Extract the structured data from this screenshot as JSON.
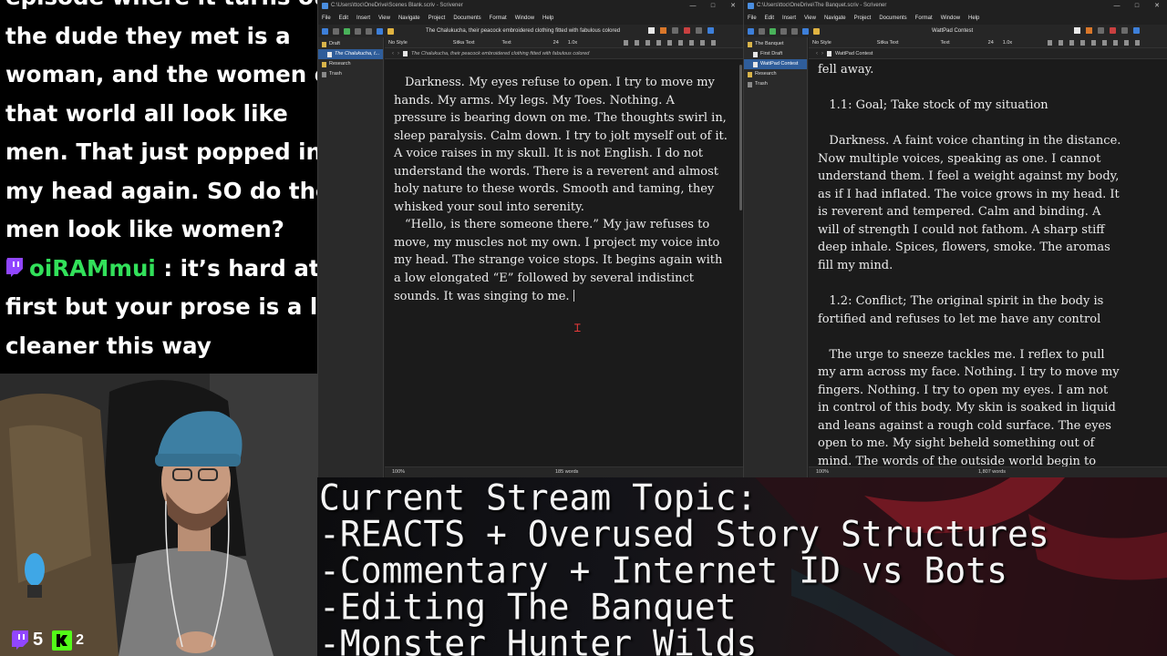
{
  "chat": {
    "lines_before": [
      "episode where it turns out",
      "the dude they met is a",
      "woman, and the women of",
      "that world all look like",
      "men. That just popped into",
      "my head again. SO do the",
      "men look like women?"
    ],
    "message": {
      "username": "oiRAMmui",
      "sep": " :",
      "first_line": " it’s hard at",
      "more_lines": [
        "first but your prose is a lot",
        "cleaner this way"
      ]
    }
  },
  "webcam": {
    "stats": [
      {
        "icon": "twitch-icon",
        "value": "5"
      },
      {
        "icon": "kick-icon",
        "value": "2"
      }
    ]
  },
  "window_left": {
    "title": "C:\\Users\\ttoc\\OneDrive\\Scenes Blank.scriv - Scrivener",
    "controls": [
      "—",
      "□",
      "✕"
    ],
    "menu": [
      "File",
      "Edit",
      "Insert",
      "View",
      "Navigate",
      "Project",
      "Documents",
      "Format",
      "Window",
      "Help"
    ],
    "doc_title": "The Chalukucha, their peacock embroidered clothing fitted with fabulous colored",
    "binder": [
      {
        "label": "Draft",
        "icon": "folder",
        "selected": false,
        "indent": false
      },
      {
        "label": "The Chalukucha, t...",
        "icon": "doc",
        "selected": true,
        "indent": true
      },
      {
        "label": "Research",
        "icon": "folder",
        "selected": false,
        "indent": false
      },
      {
        "label": "Trash",
        "icon": "trash",
        "selected": false,
        "indent": false
      }
    ],
    "format": {
      "style": "No Style",
      "font": "Sitka Text",
      "face": "Text",
      "size": "24",
      "spacing": "1.0x"
    },
    "header_text": "The Chalukucha, their peacock embroidered clothing fitted with fabulous colored",
    "paragraphs": [
      "Darkness. My eyes refuse to open. I try to move my hands. My arms. My legs. My Toes. Nothing. A pressure is bearing down on me. The thoughts swirl in, sleep paralysis. Calm down. I try to jolt myself out of it. A voice raises in my skull. It is not English. I do not understand the words. There is a reverent and almost holy nature to these words. Smooth and taming, they whisked your soul into serenity.",
      "“Hello, is there someone there.” My jaw refuses to move, my muscles not my own. I project my voice into my head. The strange voice stops. It begins again with a low elongated “E” followed by several indistinct sounds. It was singing to me."
    ],
    "zoom": "100%",
    "word_count": "185 words"
  },
  "window_right": {
    "title": "C:\\Users\\ttoc\\OneDrive\\The Banquet.scriv - Scrivener",
    "controls": [
      "—",
      "□",
      "✕"
    ],
    "menu": [
      "File",
      "Edit",
      "Insert",
      "View",
      "Navigate",
      "Project",
      "Documents",
      "Format",
      "Window",
      "Help"
    ],
    "doc_title": "WattPad Contest",
    "binder": [
      {
        "label": "The Banquet",
        "icon": "folder",
        "selected": false,
        "indent": false
      },
      {
        "label": "First Draft",
        "icon": "doc",
        "selected": false,
        "indent": true
      },
      {
        "label": "WattPad Contest",
        "icon": "doc",
        "selected": true,
        "indent": true
      },
      {
        "label": "Research",
        "icon": "folder",
        "selected": false,
        "indent": false
      },
      {
        "label": "Trash",
        "icon": "trash",
        "selected": false,
        "indent": false
      }
    ],
    "format": {
      "style": "No Style",
      "font": "Sitka Text",
      "face": "Text",
      "size": "24",
      "spacing": "1.0x"
    },
    "header_text": "WattPad Contest",
    "lines": [
      "fell away.",
      "",
      "   1.1: Goal; Take stock of my situation",
      "",
      "   Darkness. A faint voice chanting in the distance.",
      "Now multiple voices, speaking as one. I cannot",
      "understand them. I feel a weight against my body,",
      "as if I had inflated. The voice grows in my head. It",
      "is reverent and tempered. Calm and binding. A",
      "will of strength I could not fathom. A sharp stiff",
      "deep inhale. Spices, flowers, smoke. The aromas",
      "fill my mind.",
      "",
      "   1.2: Conflict; The original spirit in the body is",
      "fortified and refuses to let me have any control",
      "",
      "   The urge to sneeze tackles me. I reflex to pull",
      "my arm across my face. Nothing. I try to move my",
      "fingers. Nothing. I try to open my eyes. I am not",
      "in control of this body. My skin is soaked in liquid",
      "and leans against a rough cold surface. The eyes",
      "open to me. My sight beheld something out of",
      "mind. The words of the outside world begin to"
    ],
    "zoom": "100%",
    "word_count": "1,807 words"
  },
  "topic": {
    "lines": [
      "Current Stream Topic:",
      "-REACTS + Overused Story Structures",
      "-Commentary + Internet ID vs Bots",
      "-Editing The Banquet",
      "-Monster Hunter Wilds"
    ]
  }
}
